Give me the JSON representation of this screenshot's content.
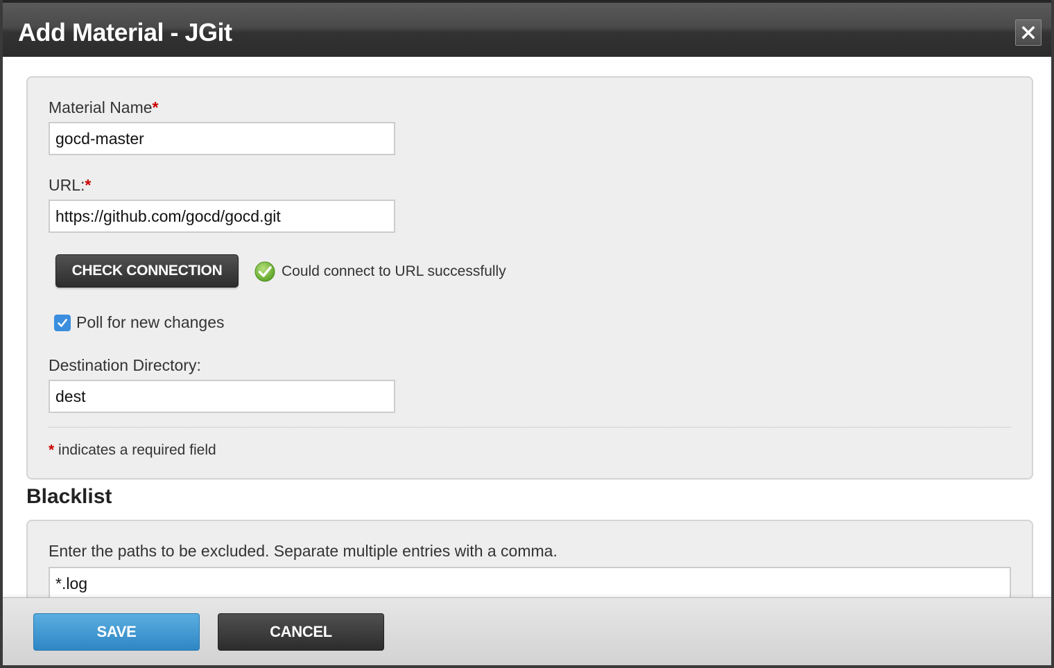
{
  "dialog": {
    "title": "Add Material - JGit",
    "close_label": "×"
  },
  "form": {
    "material_name": {
      "label": "Material Name",
      "required_mark": "*",
      "value": "gocd-master"
    },
    "url": {
      "label": "URL:",
      "required_mark": "*",
      "value": "https://github.com/gocd/gocd.git"
    },
    "check_connection": {
      "label": "CHECK CONNECTION",
      "status_text": "Could connect to URL successfully",
      "status_icon": "success-check-icon"
    },
    "poll": {
      "label": "Poll for new changes",
      "checked": true
    },
    "destination": {
      "label": "Destination Directory:",
      "value": "dest"
    },
    "required_note": {
      "mark": "*",
      "text": " indicates a required field"
    }
  },
  "blacklist": {
    "heading": "Blacklist",
    "help_text": "Enter the paths to be excluded. Separate multiple entries with a comma.",
    "value": "*.log"
  },
  "footer": {
    "save_label": "SAVE",
    "cancel_label": "CANCEL"
  },
  "colors": {
    "titlebar": "#333333",
    "required": "#cc0000",
    "save_button": "#3b95d2",
    "cancel_button": "#3a3a3a",
    "checkbox": "#3b8ede",
    "success": "#7cbf3a"
  }
}
